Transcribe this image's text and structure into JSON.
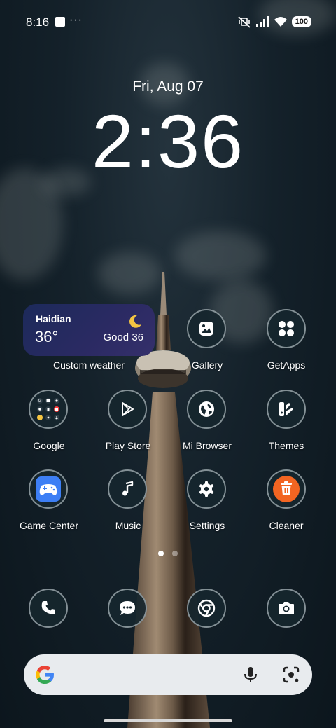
{
  "status_bar": {
    "time": "8:16",
    "more": "···",
    "battery": "100",
    "icons": [
      "notification-square-icon",
      "mute-vibrate-icon",
      "signal-icon",
      "wifi-icon",
      "battery-icon"
    ]
  },
  "clock": {
    "date": "Fri, Aug 07",
    "time": "2:36"
  },
  "weather_widget": {
    "city": "Haidian",
    "temperature": "36°",
    "condition": "Good 36",
    "icon": "moon-icon",
    "label": "Custom weather"
  },
  "apps": [
    {
      "label": "Gallery",
      "icon": "gallery-icon"
    },
    {
      "label": "GetApps",
      "icon": "getapps-icon"
    },
    {
      "label": "Google",
      "icon": "google-folder-icon"
    },
    {
      "label": "Play Store",
      "icon": "play-store-icon"
    },
    {
      "label": "Mi Browser",
      "icon": "globe-icon"
    },
    {
      "label": "Themes",
      "icon": "themes-icon"
    },
    {
      "label": "Game Center",
      "icon": "gamepad-icon"
    },
    {
      "label": "Music",
      "icon": "music-note-icon"
    },
    {
      "label": "Settings",
      "icon": "gear-icon"
    },
    {
      "label": "Cleaner",
      "icon": "trash-icon"
    }
  ],
  "dock": [
    {
      "icon": "phone-icon"
    },
    {
      "icon": "messages-icon"
    },
    {
      "icon": "chrome-icon"
    },
    {
      "icon": "camera-icon"
    }
  ],
  "pages": {
    "count": 2,
    "active": 1
  },
  "search_bar": {
    "icons": [
      "google-g-icon",
      "microphone-icon",
      "lens-icon"
    ]
  },
  "colors": {
    "icon_background": "#16262e",
    "icon_ring": "#cdd7dc",
    "game_center": "#3d7ff5",
    "cleaner": "#f26522",
    "search_bar": "#e8ebee",
    "weather_widget": "#2b2a63"
  }
}
